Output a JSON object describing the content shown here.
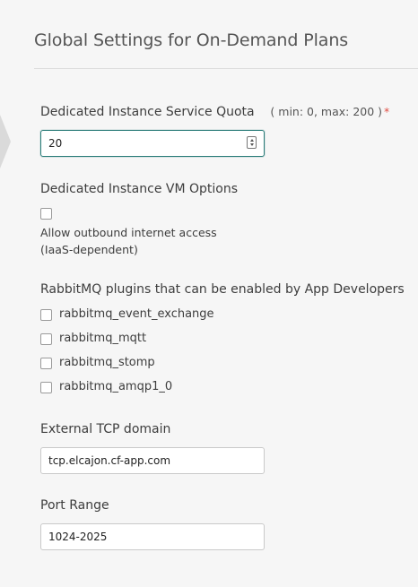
{
  "page": {
    "title": "Global Settings for On-Demand Plans"
  },
  "quota": {
    "label": "Dedicated Instance Service Quota",
    "hint": "( min: 0, max: 200 )",
    "required": "*",
    "value": "20"
  },
  "vm_options": {
    "label": "Dedicated Instance VM Options",
    "checkbox_label": "Allow outbound internet access (IaaS-dependent)"
  },
  "plugins": {
    "label": "RabbitMQ plugins that can be enabled by App Developers",
    "items": [
      {
        "label": "rabbitmq_event_exchange"
      },
      {
        "label": "rabbitmq_mqtt"
      },
      {
        "label": "rabbitmq_stomp"
      },
      {
        "label": "rabbitmq_amqp1_0"
      }
    ]
  },
  "tcp_domain": {
    "label": "External TCP domain",
    "value": "tcp.elcajon.cf-app.com"
  },
  "port_range": {
    "label": "Port Range",
    "value": "1024-2025"
  }
}
